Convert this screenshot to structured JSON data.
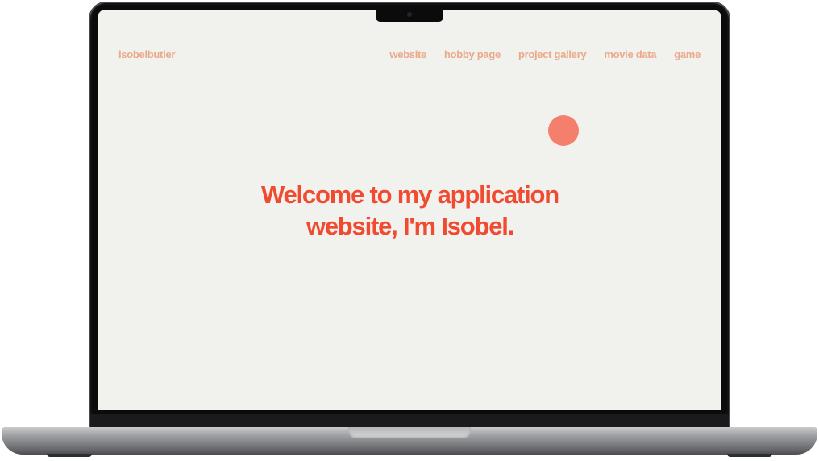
{
  "header": {
    "brand": "isobelbutler",
    "nav": [
      "website",
      "hobby page",
      "project gallery",
      "movie data",
      "game"
    ]
  },
  "hero": {
    "line1": "Welcome to my application",
    "line2": "website, I'm Isobel."
  },
  "colors": {
    "background": "#f1f1ed",
    "nav_text": "#eba98a",
    "heading": "#f04a30",
    "accent_dot": "#f47f6d"
  }
}
